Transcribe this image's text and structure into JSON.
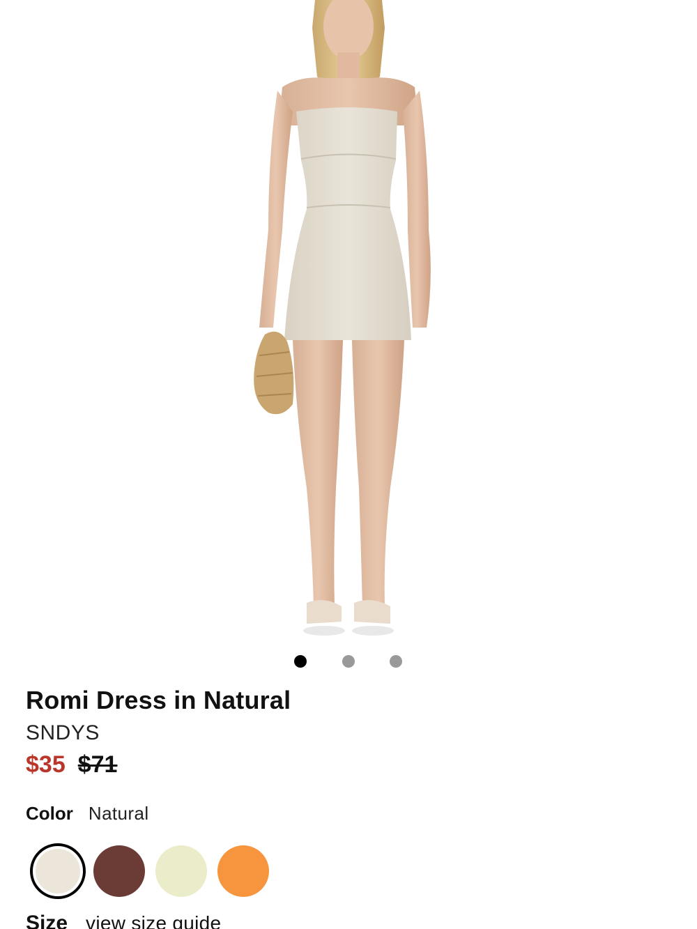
{
  "product": {
    "title": "Romi Dress in Natural",
    "brand": "SNDYS",
    "sale_price": "$35",
    "original_price": "$71",
    "sale_price_color": "#b8362a"
  },
  "carousel": {
    "image_count": 3,
    "active_index": 0,
    "image_description_icon": "product-photo"
  },
  "color": {
    "label": "Color",
    "selected_value": "Natural",
    "swatches": [
      {
        "color": "#ece6da",
        "selected": true
      },
      {
        "color": "#6b3c35",
        "selected": false
      },
      {
        "color": "#ebecc9",
        "selected": false
      },
      {
        "color": "#f7953f",
        "selected": false
      }
    ]
  },
  "size": {
    "label": "Size",
    "guide_link": "view size guide"
  }
}
